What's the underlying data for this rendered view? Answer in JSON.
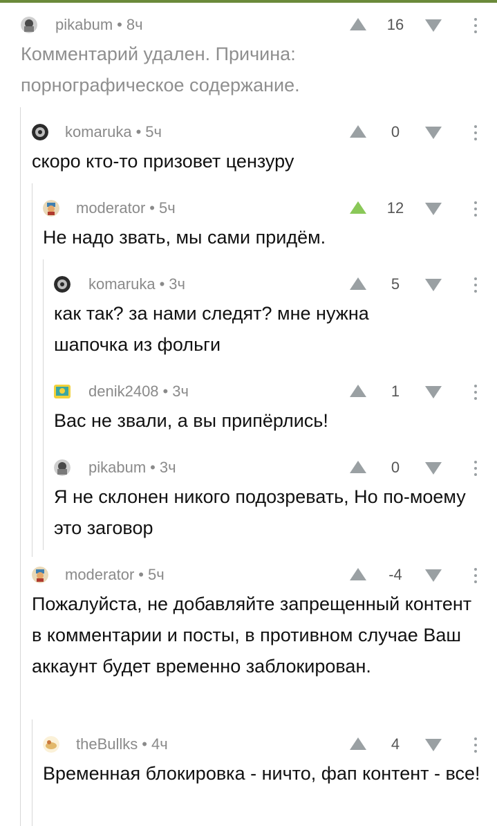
{
  "comments": [
    {
      "author": "pikabum",
      "time": "8ч",
      "score": "16",
      "text": "Комментарий удален. Причина: порнографическое содержание.",
      "avatar": "pikabum-avatar"
    },
    {
      "author": "komaruka",
      "time": "5ч",
      "score": "0",
      "text": "скоро кто-то призовет цензуру",
      "avatar": "komaruka-avatar"
    },
    {
      "author": "moderator",
      "time": "5ч",
      "score": "12",
      "text": "Не надо звать, мы сами придём.",
      "avatar": "moderator-avatar"
    },
    {
      "author": "komaruka",
      "time": "3ч",
      "score": "5",
      "text": "как так? за нами следят? мне нужна шапочка из фольги",
      "avatar": "komaruka-avatar"
    },
    {
      "author": "denik2408",
      "time": "3ч",
      "score": "1",
      "text": "Вас не звали, а вы припёрлись!",
      "avatar": "denik-avatar"
    },
    {
      "author": "pikabum",
      "time": "3ч",
      "score": "0",
      "text": "Я не склонен никого подозревать, Но по-моему это заговор",
      "avatar": "pikabum-avatar"
    },
    {
      "author": "moderator",
      "time": "5ч",
      "score": "-4",
      "text": "Пожалуйста, не добавляйте запрещенный контент в комментарии и посты, в противном случае Ваш аккаунт будет временно заблокирован.",
      "avatar": "moderator-avatar"
    },
    {
      "author": "theBullks",
      "time": "4ч",
      "score": "4",
      "text": "Временная блокировка - ничто, фап контент - все!",
      "avatar": "thebullks-avatar"
    }
  ],
  "colors": {
    "upvote_active": "#8ac858",
    "vote_icon": "#9aa0a3",
    "thread_line": "#d6d6d6",
    "accent_bar": "#6b8a3a"
  }
}
